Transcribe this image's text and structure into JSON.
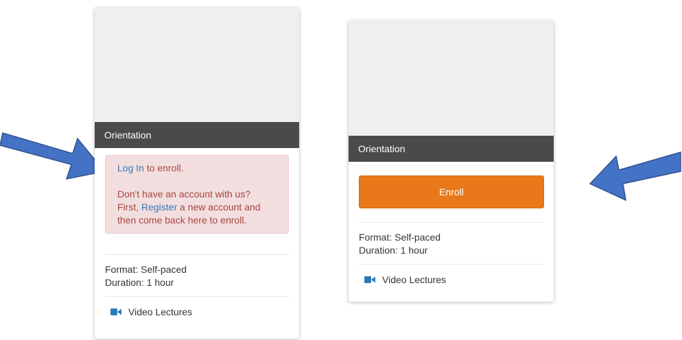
{
  "colors": {
    "title_bar": "#4a4a4a",
    "thumbnail": "#efefef",
    "alert_bg": "#f2dede",
    "alert_text": "#a94442",
    "link": "#337ab7",
    "enroll_button": "#e8781a",
    "arrow": "#4472c4",
    "video_icon": "#2a7ab8"
  },
  "left_card": {
    "course_title": "Orientation",
    "login_link": "Log In",
    "login_suffix": " to enroll.",
    "no_account_line": "Don't have an account with us?",
    "first_prefix": "First, ",
    "register_link": "Register",
    "register_suffix": " a new account and then come back here to enroll.",
    "format": "Format: Self-paced",
    "duration": "Duration: 1 hour",
    "feature_label": "Video Lectures",
    "feature_icon": "video-camera-icon"
  },
  "right_card": {
    "course_title": "Orientation",
    "enroll_label": "Enroll",
    "format": "Format: Self-paced",
    "duration": "Duration: 1 hour",
    "feature_label": "Video Lectures",
    "feature_icon": "video-camera-icon"
  },
  "annotations": {
    "left_arrow_icon": "arrow-right-down-icon",
    "right_arrow_icon": "arrow-left-down-icon"
  }
}
